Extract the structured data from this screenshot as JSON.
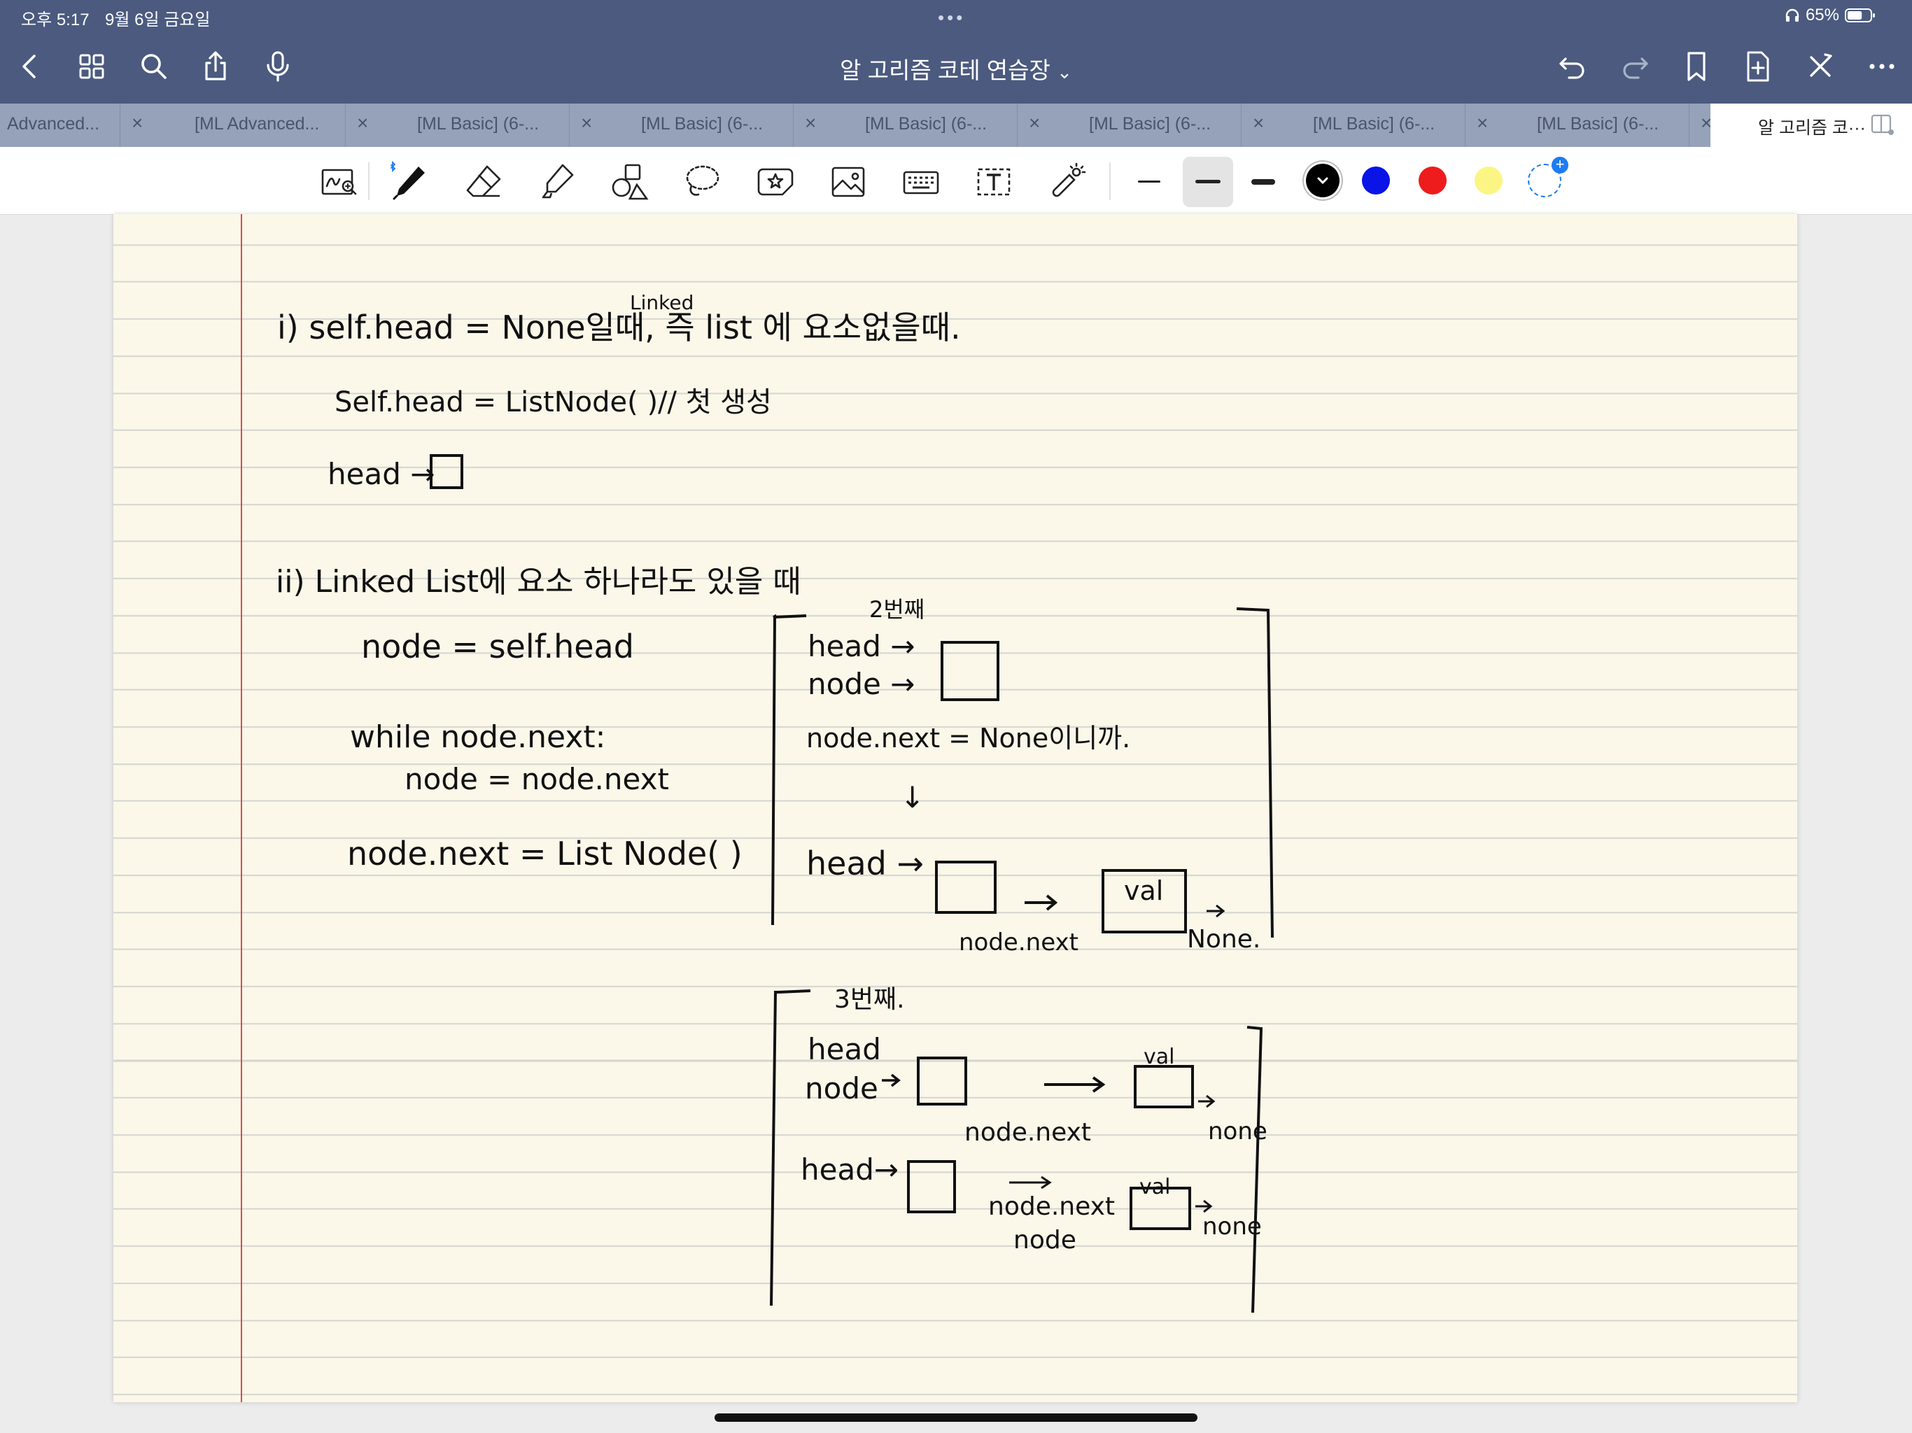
{
  "status_bar": {
    "time": "오후 5:17",
    "date": "9월 6일 금요일",
    "dots": "•••",
    "battery": "65%",
    "battery_level": 0.65
  },
  "nav": {
    "title": "알 고리즘 코테 연습장",
    "title_chevron": "⌄",
    "icons": [
      "back-icon",
      "grid-icon",
      "search-icon",
      "share-icon",
      "microphone-icon",
      "undo-icon",
      "redo-icon",
      "bookmark-icon",
      "add-page-icon",
      "close-icon",
      "more-icon"
    ]
  },
  "tabs": [
    {
      "label": "Advanced...",
      "close": "×"
    },
    {
      "label": "[ML Advanced...",
      "close": "×"
    },
    {
      "label": "[ML Basic] (6-...",
      "close": "×"
    },
    {
      "label": "[ML Basic] (6-...",
      "close": "×"
    },
    {
      "label": "[ML Basic] (6-...",
      "close": "×"
    },
    {
      "label": "[ML Basic] (6-...",
      "close": "×"
    },
    {
      "label": "[ML Basic] (6-...",
      "close": "×"
    },
    {
      "label": "[ML Basic] (6-...",
      "close": "×"
    },
    {
      "label": "알 고리즘 코···",
      "close": "",
      "active": true
    }
  ],
  "toolbar": {
    "tools": [
      "zoom-window-icon",
      "pen-icon",
      "eraser-icon",
      "highlighter-icon",
      "shapes-icon",
      "lasso-icon",
      "sticker-icon",
      "image-icon",
      "keyboard-icon",
      "text-icon",
      "laser-pointer-icon"
    ],
    "selected_tool": "pen-icon",
    "stroke_widths": [
      "thin",
      "medium",
      "thick"
    ],
    "selected_width": "medium",
    "colors": [
      "#000000",
      "#0a14e6",
      "#ee1c1c",
      "#fbf683"
    ],
    "selected_color": "#000000",
    "add_color": "+"
  },
  "note": {
    "paper_color": "#fbf8ea",
    "ink_color": "#111111",
    "margin_color": "#e8454b",
    "section1": {
      "heading": "i) self.head = None일때, 즉 list 에 요소없을때.",
      "heading_sup": "Linked",
      "line1": "Self.head = ListNode( )// 첫 생성",
      "line2": "head →"
    },
    "section2": {
      "heading": "ii) Linked List에 요소 하나라도 있을 때",
      "code1": "node = self.head",
      "code2": "while node.next:",
      "code3": "node = node.next",
      "code4": "node.next = List Node( )"
    },
    "diagram1": {
      "label": "2번째",
      "head": "head →",
      "node": "node →",
      "cond": "node.next = None이니까.",
      "down": "↓",
      "head2": "head →",
      "val": "val",
      "nodenext": "node.next",
      "none": "None."
    },
    "diagram2": {
      "label": "3번째.",
      "head": "head",
      "node": "node",
      "val1": "val",
      "nodenext1": "node.next",
      "none1": "none",
      "head2": "head→",
      "nodenext2": "node.next",
      "node2": "node",
      "val2": "val",
      "none2": "none"
    }
  }
}
